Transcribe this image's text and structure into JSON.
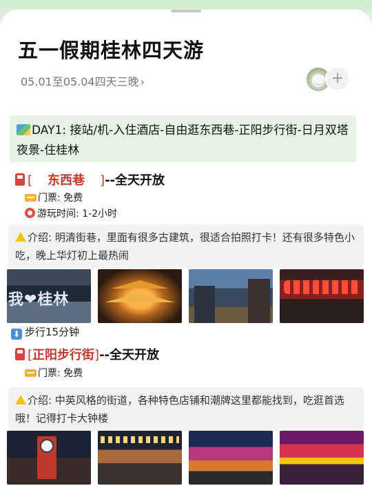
{
  "header": {
    "title": "五一假期桂林四天游",
    "subtitle": "05.01至05.04四天三晚",
    "subtitle_chevron": "›",
    "plus_label": "+"
  },
  "day1": {
    "icon": "map-icon",
    "text": "DAY1: 接站/机-入住酒店-自由逛东西巷-正阳步行街-日月双塔夜景-住桂林"
  },
  "spots": [
    {
      "open_bracket": "[",
      "name": "东西巷",
      "close_bracket": "]",
      "suffix": "--全天开放",
      "ticket": "门票: 免费",
      "time": "游玩时间: 1-2小时",
      "note": "介绍: 明清街巷，里面有很多古建筑，很适合拍照打卡！还有很多特色小吃，晚上华灯初上最热闹",
      "photo_text": "我❤桂林"
    },
    {
      "open_bracket": "[",
      "name": "正阳步行街",
      "close_bracket": "]",
      "suffix": "--全天开放",
      "ticket": "门票: 免费",
      "note": "介绍: 中英风格的街道，各种特色店铺和潮牌这里都能找到，吃逛首选哦！记得打卡大钟楼"
    }
  ],
  "walk": {
    "icon": "down-arrow-icon",
    "label": "步行15分钟"
  },
  "colors": {
    "accent_red": "#c0392b",
    "day_box_bg": "#e6f5e3",
    "note_bg": "#f2f2f2"
  }
}
